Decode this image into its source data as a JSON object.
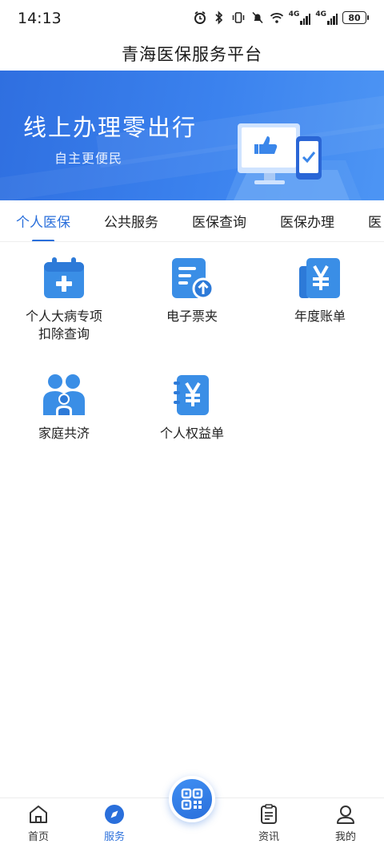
{
  "status_bar": {
    "time": "14:13",
    "battery": "80",
    "signal_1": "4G",
    "signal_2": "4G"
  },
  "header": {
    "title": "青海医保服务平台"
  },
  "banner": {
    "headline": "线上办理零出行",
    "subtitle": "自主更便民"
  },
  "tabs": [
    {
      "label": "个人医保",
      "active": true
    },
    {
      "label": "公共服务",
      "active": false
    },
    {
      "label": "医保查询",
      "active": false
    },
    {
      "label": "医保办理",
      "active": false
    },
    {
      "label": "医",
      "active": false
    }
  ],
  "services": [
    {
      "label_line1": "个人大病专项",
      "label_line2": "扣除查询",
      "icon": "calendar-plus-icon"
    },
    {
      "label_line1": "电子票夹",
      "label_line2": "",
      "icon": "e-invoice-icon"
    },
    {
      "label_line1": "年度账单",
      "label_line2": "",
      "icon": "annual-bill-icon"
    },
    {
      "label_line1": "家庭共济",
      "label_line2": "",
      "icon": "family-icon"
    },
    {
      "label_line1": "个人权益单",
      "label_line2": "",
      "icon": "yuan-book-icon"
    }
  ],
  "bottom_nav": {
    "home": "首页",
    "service": "服务",
    "news": "资讯",
    "mine": "我的"
  },
  "colors": {
    "accent": "#2a6fdb",
    "icon_blue": "#3a8ee6",
    "banner_start": "#2f6fe0",
    "banner_end": "#4d95f4"
  }
}
